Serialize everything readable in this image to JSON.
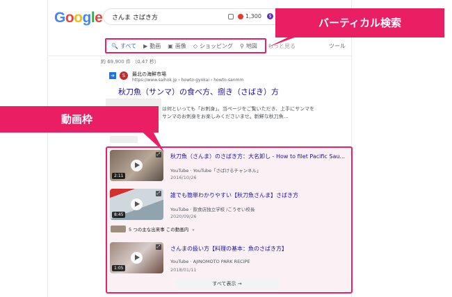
{
  "logo": "Google",
  "search": {
    "query": "さんま さばき方",
    "count": "1,300",
    "coin": "$"
  },
  "tabs": [
    {
      "icon": "🔍",
      "label": "すべて"
    },
    {
      "icon": "▶",
      "label": "動画"
    },
    {
      "icon": "▣",
      "label": "画像"
    },
    {
      "icon": "◇",
      "label": "ショッピング"
    },
    {
      "icon": "⚲",
      "label": "地図"
    }
  ],
  "tabs_more": "もっと見る",
  "tools": "ツール",
  "result_stats": "約 69,900 件 （0.47 秒）",
  "first_result": {
    "site_name": "最北の海鮮市場",
    "url": "https://www.saihok.jp › howto-gyokai › howto-sanmm",
    "title": "秋刀魚（サンマ）の食べ方、捌き（さばき）方",
    "snippet_line1": "は何といっても「お刺身」。当ページをご覧いただき、上手にサンマを",
    "snippet_line2": "サンマのお刺身をお楽しみくださいませ。新鮮な秋刀魚…"
  },
  "annotations": {
    "vertical": "バーティカル検索",
    "video_frame": "動画枠"
  },
  "videos": [
    {
      "title": "秋刀魚（さんま）のさばき方：大名卸し - How to filet Pacific Sau...",
      "source": "YouTube · YouTube「さばけるチャンネル」",
      "date": "2016/10/26",
      "duration": "2:11"
    },
    {
      "title": "誰でも簡単わかりやすい【秋刀魚さんま】さばき方",
      "source": "YouTube · 飲食店独立学校 /こうせい校長",
      "date": "2020/09/26",
      "duration": "8:45"
    },
    {
      "title": "さんまの扱い方【料理の基本：魚のさばき方】",
      "source": "YouTube · AJINOMOTO PARK RECIPE",
      "date": "2018/01/11",
      "duration": "1:05"
    }
  ],
  "key_moments": "5 つの主な出来事 この動画内",
  "show_all": "すべて表示 →",
  "colors": {
    "accent": "#e91e63",
    "link": "#1a0dab",
    "tab_active": "#1a73e8"
  }
}
